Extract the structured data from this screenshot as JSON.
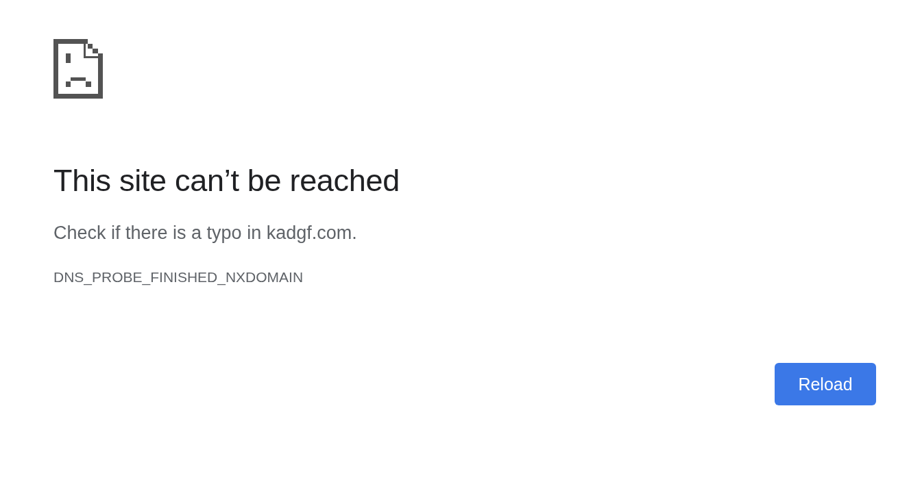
{
  "heading": "This site can’t be reached",
  "message": "Check if there is a typo in kadgf.com.",
  "error_code": "DNS_PROBE_FINISHED_NXDOMAIN",
  "buttons": [
    {
      "label": "Reload",
      "kind": "primary"
    }
  ]
}
